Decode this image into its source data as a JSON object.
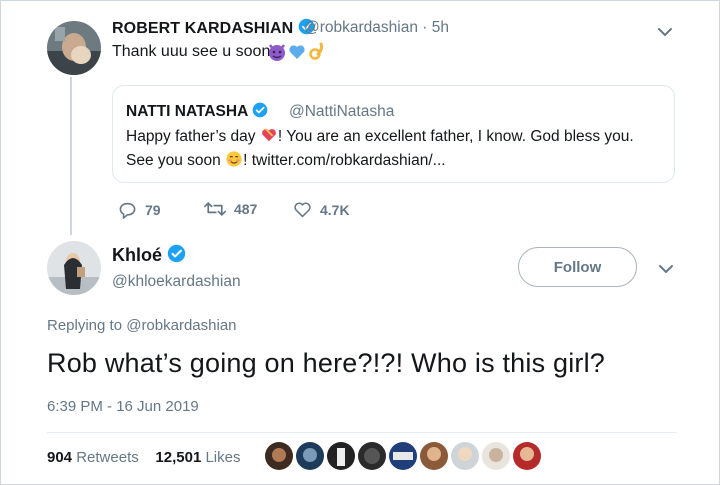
{
  "tweet1": {
    "author_name": "ROBERT KARDASHIAN",
    "handle_time": "@robkardashian · 5h",
    "text": "Thank uuu see u soon",
    "emojis": [
      "devil-emoji",
      "blue-heart-emoji",
      "ok-hand-emoji"
    ]
  },
  "quoted": {
    "author_name": "NATTI NATASHA",
    "handle": "@NattiNatasha",
    "line1_a": "Happy father’s day",
    "line1_b": "! You are an excellent father, I know. God bless you.",
    "line2_a": "See you soon",
    "line2_b": "! twitter.com/robkardashian/..."
  },
  "actions": {
    "replies": "79",
    "retweets": "487",
    "likes": "4.7K"
  },
  "tweet2": {
    "author_name": "Khloé",
    "handle": "@khloekardashian",
    "follow_label": "Follow",
    "replying_to": "Replying to @robkardashian",
    "text": "Rob what’s going on here?!?! Who is this girl?",
    "timestamp": "6:39 PM - 16 Jun 2019",
    "retweets_count": "904",
    "retweets_label": "Retweets",
    "likes_count": "12,501",
    "likes_label": "Likes"
  },
  "colors": {
    "verified": "#1da1f2",
    "secondary_text": "#657786",
    "divider": "#e6ecf0"
  }
}
